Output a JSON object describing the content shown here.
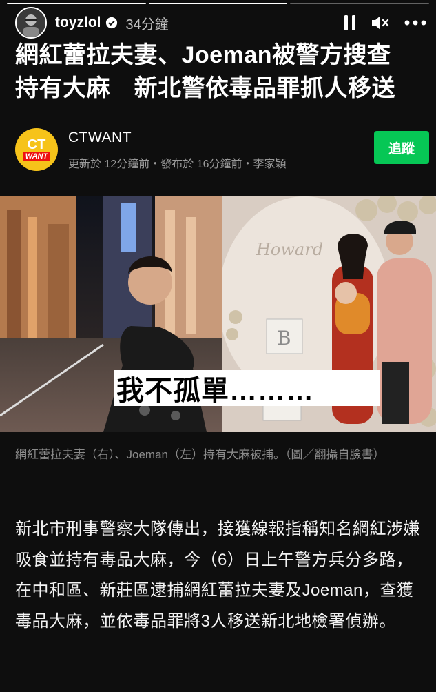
{
  "story": {
    "username": "toyzlol",
    "time_ago": "34分鐘",
    "icons": [
      "pause-icon",
      "mute-icon",
      "more-icon"
    ]
  },
  "article": {
    "headline_line1": "網紅蕾拉夫妻、Joeman被警方搜查",
    "headline_line2": "持有大麻　新北警依毒品罪抓人移送",
    "publisher": {
      "logo_ct": "CT",
      "logo_want": "WANT",
      "name": "CTWANT",
      "meta": "更新於 12分鐘前・發布於 16分鐘前・李家穎",
      "follow_label": "追蹤",
      "follow_color": "#06c755"
    },
    "photo": {
      "overlay_text": "我不孤單………",
      "caption": "網紅蕾拉夫妻（右）、Joeman（左）持有大麻被捕。（圖／翻攝自臉書）"
    },
    "body": "新北市刑事警察大隊傳出，接獲線報指稱知名網紅涉嫌吸食並持有毒品大麻，今（6）日上午警方兵分多路，在中和區、新莊區逮捕網紅蕾拉夫妻及Joeman，查獲毒品大麻，並依毒品罪將3人移送新北地檢署偵辦。"
  }
}
